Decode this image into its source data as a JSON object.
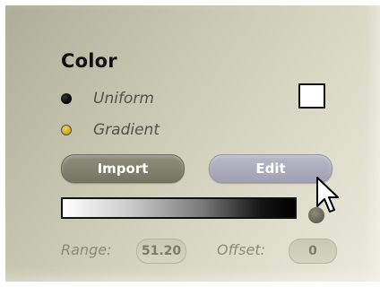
{
  "section": {
    "title": "Color"
  },
  "color_mode": {
    "options": [
      {
        "label": "Uniform",
        "selected": true
      },
      {
        "label": "Gradient",
        "selected": false
      }
    ]
  },
  "swatch": {
    "color": "#ffffff"
  },
  "buttons": {
    "import_label": "Import",
    "edit_label": "Edit"
  },
  "gradient": {
    "from_color": "#ffffff",
    "to_color": "#000000"
  },
  "fields": {
    "range_label": "Range:",
    "range_value": "51.20",
    "offset_label": "Offset:",
    "offset_value": "0"
  },
  "colors": {
    "panel_bg": "#cfceba",
    "import_button": "#7f7e6b",
    "edit_button": "#acacbd",
    "radio_unselected": "#e3bd34"
  },
  "icons": {
    "cursor": "arrow-cursor-icon",
    "knob": "dial-knob-icon"
  }
}
